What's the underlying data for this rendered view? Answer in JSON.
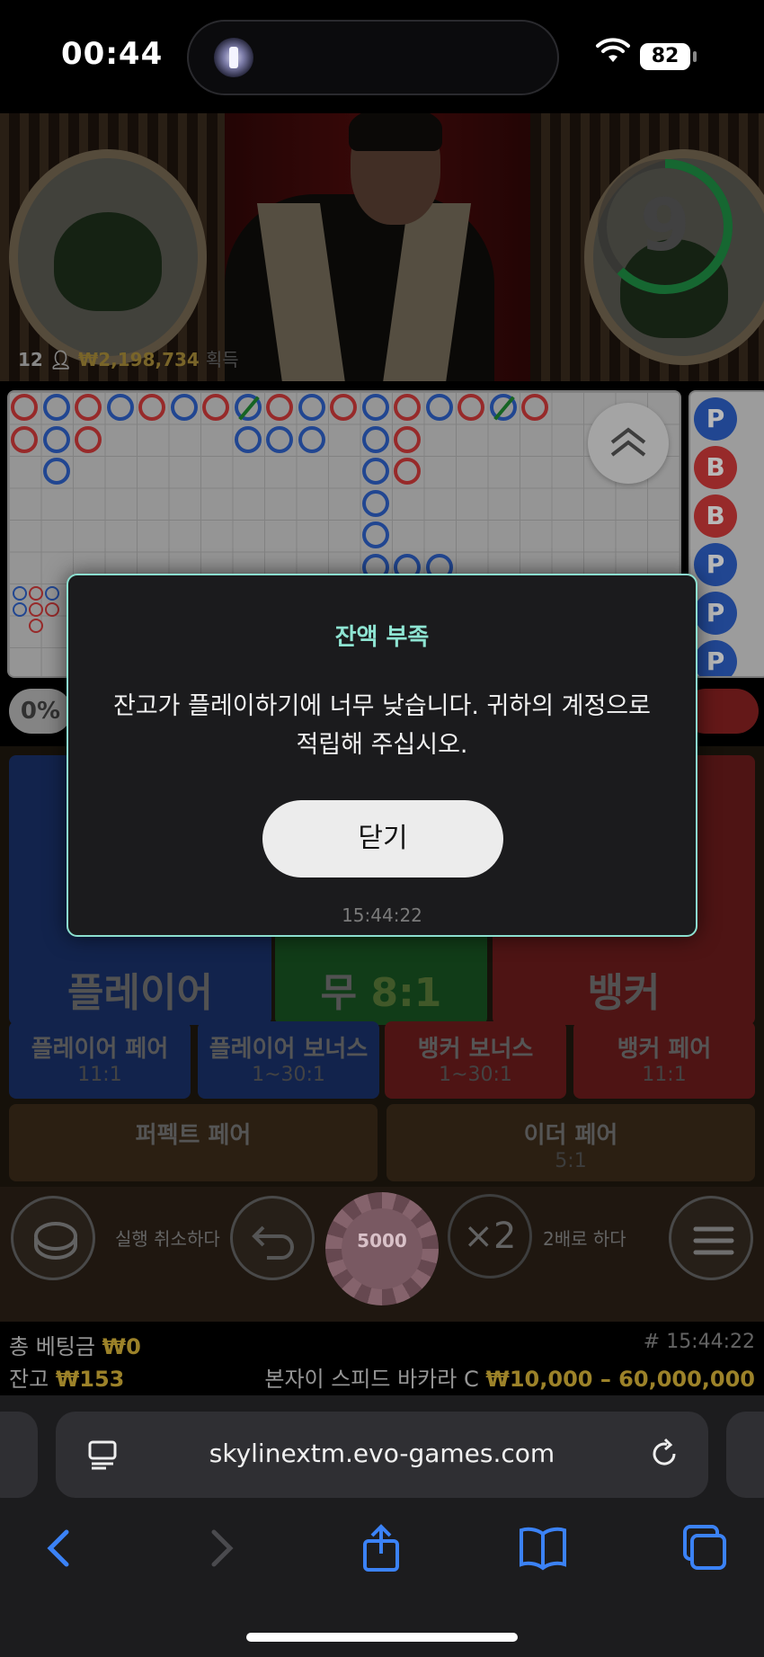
{
  "status_bar": {
    "time": "00:44",
    "battery": "82"
  },
  "video": {
    "timer": "9",
    "players": "12",
    "winnings": "₩2,198,734",
    "winnings_label": "획득"
  },
  "roadmap": {
    "percent": "0%",
    "side_beads": [
      "P",
      "B",
      "B",
      "P",
      "P",
      "P"
    ]
  },
  "bets": {
    "player": "플레이어",
    "tie": "무",
    "tie_odds": "8:1",
    "banker": "뱅커",
    "player_pair": {
      "label": "플레이어 페어",
      "odds": "11:1"
    },
    "player_bonus": {
      "label": "플레이어 보너스",
      "odds": "1~30:1"
    },
    "banker_bonus": {
      "label": "뱅커 보너스",
      "odds": "1~30:1"
    },
    "banker_pair": {
      "label": "뱅커 페어",
      "odds": "11:1"
    },
    "perfect_pair": {
      "label": "퍼펙트 페어"
    },
    "either_pair": {
      "label": "이더 페어",
      "odds": "5:1"
    }
  },
  "controls": {
    "undo_label": "실행 취소하다",
    "chip_value": "5000",
    "double_symbol": "×2",
    "double_label": "2배로 하다"
  },
  "info": {
    "total_bet_label": "총 베팅금",
    "total_bet": "₩0",
    "balance_label": "잔고",
    "balance": "₩153",
    "round": "# 15:44:22",
    "table_name": "본자이 스피드 바카라 C",
    "limits": "₩10,000 – 60,000,000"
  },
  "browser": {
    "url": "skylinextm.evo-games.com"
  },
  "dialog": {
    "title": "잔액 부족",
    "message": "잔고가 플레이하기에 너무 낮습니다. 귀하의 계정으로 적립해 주십시오.",
    "button": "닫기",
    "time": "15:44:22"
  },
  "colors": {
    "player_blue": "#2e5ac2",
    "banker_red": "#c73636",
    "tie_green": "#2d9a3f",
    "accent_gold": "#d8b439",
    "dialog_accent": "#8ee4d2"
  }
}
